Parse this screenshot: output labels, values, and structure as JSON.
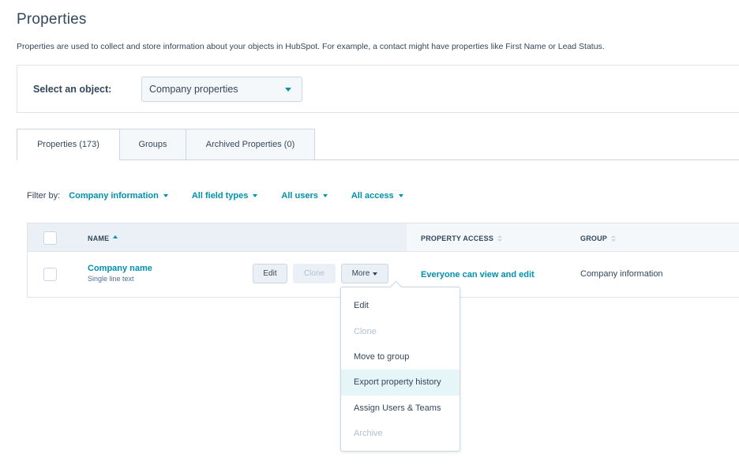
{
  "page": {
    "title": "Properties",
    "description": "Properties are used to collect and store information about your objects in HubSpot. For example, a contact might have properties like First Name or Lead Status."
  },
  "object_selector": {
    "label": "Select an object:",
    "value": "Company properties"
  },
  "tabs": [
    {
      "label": "Properties (173)",
      "active": true
    },
    {
      "label": "Groups",
      "active": false
    },
    {
      "label": "Archived Properties (0)",
      "active": false
    }
  ],
  "filters": {
    "label": "Filter by:",
    "items": [
      "Company information",
      "All field types",
      "All users",
      "All access"
    ]
  },
  "table": {
    "columns": {
      "name": "NAME",
      "access": "PROPERTY ACCESS",
      "group": "GROUP"
    },
    "rows": [
      {
        "name": "Company name",
        "type": "Single line text",
        "access": "Everyone can view and edit",
        "group": "Company information",
        "actions": {
          "edit": "Edit",
          "clone": "Clone",
          "more": "More"
        }
      }
    ]
  },
  "more_menu": {
    "items": [
      {
        "label": "Edit",
        "disabled": false
      },
      {
        "label": "Clone",
        "disabled": true
      },
      {
        "label": "Move to group",
        "disabled": false
      },
      {
        "label": "Export property history",
        "disabled": false,
        "highlighted": true
      },
      {
        "label": "Assign Users & Teams",
        "disabled": false
      },
      {
        "label": "Archive",
        "disabled": true
      }
    ]
  },
  "colors": {
    "text": "#33475b",
    "link": "#0091ae",
    "border": "#cbd6e2",
    "header_bg": "#f5f8fa",
    "highlight": "#e5f5f8",
    "disabled": "#b0c1d4"
  }
}
